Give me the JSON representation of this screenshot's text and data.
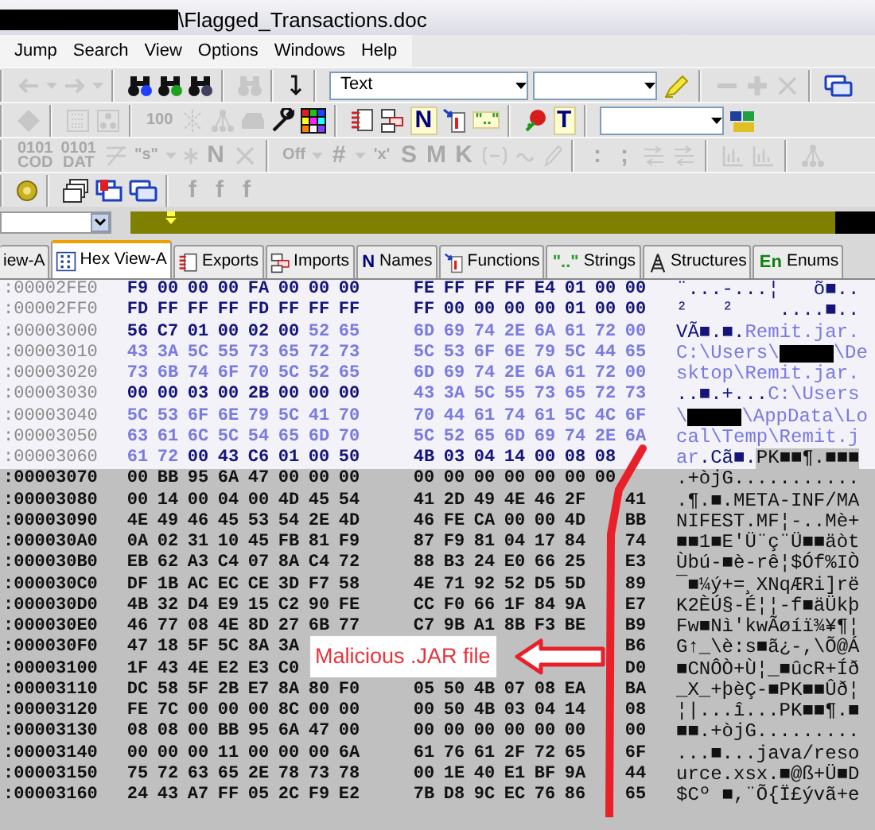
{
  "window": {
    "title": [
      {
        "kind": "redacted"
      },
      {
        "kind": "text",
        "text": "\\Flagged_Transactions.doc"
      }
    ]
  },
  "menu": [
    {
      "label": "Jump"
    },
    {
      "label": "Search"
    },
    {
      "label": "View"
    },
    {
      "label": "Options"
    },
    {
      "label": "Windows"
    },
    {
      "label": "Help"
    }
  ],
  "toolbars": [
    {
      "bands": [
        {
          "items": [
            {
              "kind": "icon",
              "disabled": true
            },
            {
              "kind": "icon",
              "disabled": true
            },
            {
              "kind": "icon",
              "disabled": true
            },
            {
              "kind": "icon",
              "disabled": true
            }
          ]
        },
        {
          "items": [
            {
              "kind": "icon",
              "disabled": false
            },
            {
              "kind": "icon",
              "disabled": false
            },
            {
              "kind": "icon",
              "disabled": false
            }
          ]
        },
        {
          "items": [
            {
              "kind": "icon",
              "disabled": true
            }
          ]
        },
        {
          "items": [
            {
              "kind": "icon",
              "disabled": false
            }
          ]
        },
        {
          "items": [
            {
              "kind": "combo",
              "value": "Text"
            },
            {
              "kind": "combo"
            },
            {
              "kind": "icon",
              "disabled": false
            }
          ]
        },
        {
          "items": [
            {
              "kind": "icon",
              "disabled": true
            },
            {
              "kind": "icon",
              "disabled": true
            },
            {
              "kind": "icon",
              "disabled": true
            }
          ]
        },
        {
          "items": [
            {
              "kind": "icon",
              "disabled": false
            }
          ]
        }
      ]
    },
    {
      "bands": [
        {
          "items": [
            {
              "kind": "icon",
              "disabled": true
            }
          ]
        },
        {
          "items": [
            {
              "kind": "icon",
              "disabled": true
            },
            {
              "kind": "icon",
              "disabled": true
            }
          ]
        },
        {
          "items": [
            {
              "kind": "glyph",
              "text": "100",
              "disabled": true
            },
            {
              "kind": "icon",
              "disabled": true
            },
            {
              "kind": "icon",
              "disabled": true
            },
            {
              "kind": "icon",
              "disabled": true
            },
            {
              "kind": "icon",
              "disabled": false
            },
            {
              "kind": "icon",
              "disabled": false
            }
          ]
        },
        {
          "items": [
            {
              "kind": "icon",
              "disabled": false
            },
            {
              "kind": "icon",
              "disabled": false
            },
            {
              "kind": "glyph",
              "text": "N",
              "disabled": false,
              "color": "#000080"
            },
            {
              "kind": "icon",
              "disabled": false
            },
            {
              "kind": "glyph",
              "text": "\"..\"",
              "disabled": false,
              "color": "#2a9a2a"
            }
          ]
        },
        {
          "items": [
            {
              "kind": "icon",
              "disabled": false
            },
            {
              "kind": "glyph",
              "text": "T",
              "disabled": false,
              "color": "#000080"
            }
          ]
        },
        {
          "items": [
            {
              "kind": "combo"
            },
            {
              "kind": "icon",
              "disabled": false
            }
          ]
        }
      ]
    },
    {
      "bands": [
        {
          "items": [
            {
              "kind": "glyph",
              "text": "0101\nCOD",
              "disabled": true
            },
            {
              "kind": "glyph",
              "text": "0101\nDAT",
              "disabled": true
            },
            {
              "kind": "icon",
              "disabled": true
            },
            {
              "kind": "glyph",
              "text": "\"s\"",
              "disabled": true
            },
            {
              "kind": "icon",
              "disabled": true
            },
            {
              "kind": "icon",
              "disabled": true
            },
            {
              "kind": "glyph",
              "text": "N",
              "disabled": true
            },
            {
              "kind": "icon",
              "disabled": true
            }
          ]
        },
        {
          "items": [
            {
              "kind": "glyph",
              "text": "Off",
              "disabled": true
            },
            {
              "kind": "icon",
              "disabled": true
            },
            {
              "kind": "glyph",
              "text": "#",
              "disabled": true
            },
            {
              "kind": "icon",
              "disabled": true
            },
            {
              "kind": "glyph",
              "text": "'x'",
              "disabled": true
            },
            {
              "kind": "glyph",
              "text": "S",
              "disabled": true
            },
            {
              "kind": "glyph",
              "text": "M",
              "disabled": true
            },
            {
              "kind": "glyph",
              "text": "K",
              "disabled": true
            },
            {
              "kind": "icon",
              "disabled": true
            },
            {
              "kind": "icon",
              "disabled": true
            },
            {
              "kind": "icon",
              "disabled": true
            }
          ]
        },
        {
          "items": [
            {
              "kind": "glyph",
              "text": ":",
              "disabled": true
            },
            {
              "kind": "glyph",
              "text": ";",
              "disabled": true
            },
            {
              "kind": "icon",
              "disabled": true
            },
            {
              "kind": "icon",
              "disabled": true
            }
          ]
        },
        {
          "items": [
            {
              "kind": "icon",
              "disabled": true
            },
            {
              "kind": "icon",
              "disabled": true
            }
          ]
        },
        {
          "items": [
            {
              "kind": "icon",
              "disabled": true
            }
          ]
        }
      ]
    },
    {
      "bands": [
        {
          "items": [
            {
              "kind": "icon",
              "disabled": false
            }
          ]
        },
        {
          "items": [
            {
              "kind": "icon",
              "disabled": false
            },
            {
              "kind": "icon",
              "disabled": false
            },
            {
              "kind": "icon",
              "disabled": false
            }
          ]
        },
        {
          "items": [
            {
              "kind": "glyph",
              "text": "f",
              "disabled": true
            },
            {
              "kind": "glyph",
              "text": "f",
              "disabled": true
            },
            {
              "kind": "glyph",
              "text": "f",
              "disabled": true
            }
          ]
        }
      ]
    }
  ],
  "tabs": [
    {
      "label": "iew-A",
      "selected": false
    },
    {
      "label": "Hex View-A",
      "selected": true
    },
    {
      "label": "Exports",
      "selected": false
    },
    {
      "label": "Imports",
      "selected": false
    },
    {
      "label": "Names",
      "selected": false,
      "glyph": "N"
    },
    {
      "label": "Functions",
      "selected": false
    },
    {
      "label": "Strings",
      "selected": false,
      "glyph": "\"..\""
    },
    {
      "label": "Structures",
      "selected": false
    },
    {
      "label": "Enums",
      "selected": false,
      "glyph": "En"
    }
  ],
  "hex_rows": [
    {
      "address": ":00002FE0",
      "unexplored": false,
      "hex": [
        {
          "kind": "data",
          "bytes": [
            "F9",
            "00",
            "00",
            "00",
            "FA",
            "00",
            "00",
            "00",
            "FE",
            "FF",
            "FF",
            "FF",
            "E4",
            "01",
            "00",
            "00"
          ]
        }
      ],
      "ascii": [
        {
          "kind": "data",
          "text": "¨...-...¦   õ■.."
        }
      ]
    },
    {
      "address": ":00002FF0",
      "unexplored": false,
      "hex": [
        {
          "kind": "data",
          "bytes": [
            "FD",
            "FF",
            "FF",
            "FF",
            "FD",
            "FF",
            "FF",
            "FF",
            "FF",
            "00",
            "00",
            "00",
            "00",
            "01",
            "00",
            "00"
          ]
        }
      ],
      "ascii": [
        {
          "kind": "data",
          "text": "²   ²    ....■.."
        }
      ]
    },
    {
      "address": ":00003000",
      "unexplored": false,
      "hex": [
        {
          "kind": "data",
          "bytes": [
            "56",
            "C7",
            "01",
            "00",
            "02",
            "00"
          ]
        },
        {
          "kind": "string",
          "bytes": [
            "52",
            "65",
            "6D",
            "69",
            "74",
            "2E",
            "6A",
            "61",
            "72",
            "00"
          ]
        }
      ],
      "ascii": [
        {
          "kind": "data",
          "text": "VÃ■.■."
        },
        {
          "kind": "string",
          "text": "Remit.jar."
        }
      ]
    },
    {
      "address": ":00003010",
      "unexplored": false,
      "hex": [
        {
          "kind": "string",
          "bytes": [
            "43",
            "3A",
            "5C",
            "55",
            "73",
            "65",
            "72",
            "73",
            "5C",
            "53",
            "6F",
            "6E",
            "79",
            "5C",
            "44",
            "65"
          ]
        }
      ],
      "ascii": [
        {
          "kind": "string",
          "text": "C:\\Users\\"
        },
        {
          "kind": "redacted"
        },
        {
          "kind": "string",
          "text": "\\De"
        }
      ]
    },
    {
      "address": ":00003020",
      "unexplored": false,
      "hex": [
        {
          "kind": "string",
          "bytes": [
            "73",
            "6B",
            "74",
            "6F",
            "70",
            "5C",
            "52",
            "65",
            "6D",
            "69",
            "74",
            "2E",
            "6A",
            "61",
            "72",
            "00"
          ]
        }
      ],
      "ascii": [
        {
          "kind": "string",
          "text": "sktop\\Remit.jar."
        }
      ]
    },
    {
      "address": ":00003030",
      "unexplored": false,
      "hex": [
        {
          "kind": "data",
          "bytes": [
            "00",
            "00",
            "03",
            "00",
            "2B",
            "00",
            "00",
            "00"
          ]
        },
        {
          "kind": "string",
          "bytes": [
            "43",
            "3A",
            "5C",
            "55",
            "73",
            "65",
            "72",
            "73"
          ]
        }
      ],
      "ascii": [
        {
          "kind": "data",
          "text": "..■.+..."
        },
        {
          "kind": "string",
          "text": "C:\\Users"
        }
      ]
    },
    {
      "address": ":00003040",
      "unexplored": false,
      "hex": [
        {
          "kind": "string",
          "bytes": [
            "5C",
            "53",
            "6F",
            "6E",
            "79",
            "5C",
            "41",
            "70",
            "70",
            "44",
            "61",
            "74",
            "61",
            "5C",
            "4C",
            "6F"
          ]
        }
      ],
      "ascii": [
        {
          "kind": "string",
          "text": "\\"
        },
        {
          "kind": "redacted"
        },
        {
          "kind": "string",
          "text": "\\AppData\\Lo"
        }
      ]
    },
    {
      "address": ":00003050",
      "unexplored": false,
      "hex": [
        {
          "kind": "string",
          "bytes": [
            "63",
            "61",
            "6C",
            "5C",
            "54",
            "65",
            "6D",
            "70",
            "5C",
            "52",
            "65",
            "6D",
            "69",
            "74",
            "2E",
            "6A"
          ]
        }
      ],
      "ascii": [
        {
          "kind": "string",
          "text": "cal\\Temp\\Remit.j"
        }
      ]
    },
    {
      "address": ":00003060",
      "unexplored": false,
      "hex": [
        {
          "kind": "string",
          "bytes": [
            "61",
            "72"
          ]
        },
        {
          "kind": "data",
          "bytes": [
            "00",
            "43",
            "C6",
            "01",
            "00",
            "50",
            "4B",
            "03",
            "04",
            "14",
            "00",
            "08",
            "08"
          ]
        }
      ],
      "ascii": [
        {
          "kind": "string",
          "text": "ar"
        },
        {
          "kind": "data",
          "text": ".Cã■."
        },
        {
          "kind": "unexplored",
          "text": "PK■■¶.■■■"
        }
      ]
    },
    {
      "address": ":00003070",
      "unexplored": true,
      "hex": [
        {
          "kind": "unexplored",
          "bytes": [
            "00",
            "BB",
            "95",
            "6A",
            "47",
            "00",
            "00",
            "00",
            "00",
            "00",
            "00",
            "00",
            "00",
            "00",
            "00"
          ]
        }
      ],
      "ascii": [
        {
          "kind": "unexplored",
          "text": ".+òjG..........."
        }
      ]
    },
    {
      "address": ":00003080",
      "unexplored": true,
      "hex": [
        {
          "kind": "unexplored",
          "bytes": [
            "00",
            "14",
            "00",
            "04",
            "00",
            "4D",
            "45",
            "54",
            "41",
            "2D",
            "49",
            "4E",
            "46",
            "2F"
          ]
        },
        {
          "kind": "unexplored",
          "bytes": [
            "41"
          ],
          "at_end": true
        }
      ],
      "ascii": [
        {
          "kind": "unexplored",
          "text": ".¶.■.META-INF/MA"
        }
      ]
    },
    {
      "address": ":00003090",
      "unexplored": true,
      "hex": [
        {
          "kind": "unexplored",
          "bytes": [
            "4E",
            "49",
            "46",
            "45",
            "53",
            "54",
            "2E",
            "4D",
            "46",
            "FE",
            "CA",
            "00",
            "00",
            "4D"
          ]
        },
        {
          "kind": "unexplored",
          "bytes": [
            "BB"
          ],
          "at_end": true
        }
      ],
      "ascii": [
        {
          "kind": "unexplored",
          "text": "NIFEST.MF¦-..Mè+"
        }
      ]
    },
    {
      "address": ":000030A0",
      "unexplored": true,
      "hex": [
        {
          "kind": "unexplored",
          "bytes": [
            "0A",
            "02",
            "31",
            "10",
            "45",
            "FB",
            "81",
            "F9",
            "87",
            "F9",
            "81",
            "04",
            "17",
            "84"
          ]
        },
        {
          "kind": "unexplored",
          "bytes": [
            "74"
          ],
          "at_end": true
        }
      ],
      "ascii": [
        {
          "kind": "unexplored",
          "text": "■■1■E'Ü¨ç¨Ü■■äòt"
        }
      ]
    },
    {
      "address": ":000030B0",
      "unexplored": true,
      "hex": [
        {
          "kind": "unexplored",
          "bytes": [
            "EB",
            "62",
            "A3",
            "C4",
            "07",
            "8A",
            "C4",
            "72",
            "88",
            "B3",
            "24",
            "E0",
            "66",
            "25"
          ]
        },
        {
          "kind": "unexplored",
          "bytes": [
            "E3"
          ],
          "at_end": true
        }
      ],
      "ascii": [
        {
          "kind": "unexplored",
          "text": "Ùbú-■è-rê¦$Óf%IÒ"
        }
      ]
    },
    {
      "address": ":000030C0",
      "unexplored": true,
      "hex": [
        {
          "kind": "unexplored",
          "bytes": [
            "DF",
            "1B",
            "AC",
            "EC",
            "CE",
            "3D",
            "F7",
            "58",
            "4E",
            "71",
            "92",
            "52",
            "D5",
            "5D"
          ]
        },
        {
          "kind": "unexplored",
          "bytes": [
            "89"
          ],
          "at_end": true
        }
      ],
      "ascii": [
        {
          "kind": "unexplored",
          "text": "¯■¼ý+=¸XNqÆRi]rë"
        }
      ]
    },
    {
      "address": ":000030D0",
      "unexplored": true,
      "hex": [
        {
          "kind": "unexplored",
          "bytes": [
            "4B",
            "32",
            "D4",
            "E9",
            "15",
            "C2",
            "90",
            "FE",
            "CC",
            "F0",
            "66",
            "1F",
            "84",
            "9A"
          ]
        },
        {
          "kind": "unexplored",
          "bytes": [
            "E7"
          ],
          "at_end": true
        }
      ],
      "ascii": [
        {
          "kind": "unexplored",
          "text": "K2ÈÚ§-É¦¦-f■äÜkþ"
        }
      ]
    },
    {
      "address": ":000030E0",
      "unexplored": true,
      "hex": [
        {
          "kind": "unexplored",
          "bytes": [
            "46",
            "77",
            "08",
            "4E",
            "8D",
            "27",
            "6B",
            "77",
            "C7",
            "9B",
            "A1",
            "8B",
            "F3",
            "BE"
          ]
        },
        {
          "kind": "unexplored",
          "bytes": [
            "B9"
          ],
          "at_end": true
        }
      ],
      "ascii": [
        {
          "kind": "unexplored",
          "text": "Fw■Nì'kwÃøíï¾¥¶¦"
        }
      ]
    },
    {
      "address": ":000030F0",
      "unexplored": true,
      "hex": [
        {
          "kind": "unexplored",
          "bytes": [
            "47",
            "18",
            "5F",
            "5C",
            "8A",
            "3A"
          ]
        },
        {
          "kind": "unexplored",
          "bytes": [
            "B6"
          ],
          "at_end": true
        }
      ],
      "ascii": [
        {
          "kind": "unexplored",
          "text": "G↑_\\è:s■ã¿-,\\Õ@Á"
        }
      ]
    },
    {
      "address": ":00003100",
      "unexplored": true,
      "hex": [
        {
          "kind": "unexplored",
          "bytes": [
            "1F",
            "43",
            "4E",
            "E2",
            "E3",
            "C0"
          ]
        },
        {
          "kind": "unexplored",
          "bytes": [
            "D0"
          ],
          "at_end": true
        }
      ],
      "ascii": [
        {
          "kind": "unexplored",
          "text": "■CNÔÒ+Ù¦_■ûcR+Íð"
        }
      ]
    },
    {
      "address": ":00003110",
      "unexplored": true,
      "hex": [
        {
          "kind": "unexplored",
          "bytes": [
            "DC",
            "58",
            "5F",
            "2B",
            "E7",
            "8A",
            "80",
            "F0",
            "05",
            "50",
            "4B",
            "07",
            "08",
            "EA"
          ]
        },
        {
          "kind": "unexplored",
          "bytes": [
            "BA"
          ],
          "at_end": true
        }
      ],
      "ascii": [
        {
          "kind": "unexplored",
          "text": "_X_+þèÇ-■PK■■Ûð¦"
        }
      ]
    },
    {
      "address": ":00003120",
      "unexplored": true,
      "hex": [
        {
          "kind": "unexplored",
          "bytes": [
            "FE",
            "7C",
            "00",
            "00",
            "00",
            "8C",
            "00",
            "00",
            "00",
            "50",
            "4B",
            "03",
            "04",
            "14"
          ]
        },
        {
          "kind": "unexplored",
          "bytes": [
            "08"
          ],
          "at_end": true
        }
      ],
      "ascii": [
        {
          "kind": "unexplored",
          "text": "¦|...î...PK■■¶.■"
        }
      ]
    },
    {
      "address": ":00003130",
      "unexplored": true,
      "hex": [
        {
          "kind": "unexplored",
          "bytes": [
            "08",
            "08",
            "00",
            "BB",
            "95",
            "6A",
            "47",
            "00",
            "00",
            "00",
            "00",
            "00",
            "00",
            "00"
          ]
        },
        {
          "kind": "unexplored",
          "bytes": [
            "00"
          ],
          "at_end": true
        }
      ],
      "ascii": [
        {
          "kind": "unexplored",
          "text": "■■.+òjG........."
        }
      ]
    },
    {
      "address": ":00003140",
      "unexplored": true,
      "hex": [
        {
          "kind": "unexplored",
          "bytes": [
            "00",
            "00",
            "00",
            "11",
            "00",
            "00",
            "00",
            "6A",
            "61",
            "76",
            "61",
            "2F",
            "72",
            "65"
          ]
        },
        {
          "kind": "unexplored",
          "bytes": [
            "6F"
          ],
          "at_end": true
        }
      ],
      "ascii": [
        {
          "kind": "unexplored",
          "text": "...■...java/reso"
        }
      ]
    },
    {
      "address": ":00003150",
      "unexplored": true,
      "hex": [
        {
          "kind": "unexplored",
          "bytes": [
            "75",
            "72",
            "63",
            "65",
            "2E",
            "78",
            "73",
            "78",
            "00",
            "1E",
            "40",
            "E1",
            "BF",
            "9A"
          ]
        },
        {
          "kind": "unexplored",
          "bytes": [
            "44"
          ],
          "at_end": true
        }
      ],
      "ascii": [
        {
          "kind": "unexplored",
          "text": "urce.xsx.■@ß+Ü■D"
        }
      ]
    },
    {
      "address": ":00003160",
      "unexplored": true,
      "hex": [
        {
          "kind": "unexplored",
          "bytes": [
            "24",
            "43",
            "A7",
            "FF",
            "05",
            "2C",
            "F9",
            "E2",
            "7B",
            "D8",
            "9C",
            "EC",
            "76",
            "86"
          ]
        },
        {
          "kind": "unexplored",
          "bytes": [
            "65"
          ],
          "at_end": true
        }
      ],
      "ascii": [
        {
          "kind": "unexplored",
          "text": "$Cº ■,¨Õ{Ï£ývã+e"
        }
      ]
    }
  ],
  "callout": {
    "text": "Malicious .JAR file"
  }
}
